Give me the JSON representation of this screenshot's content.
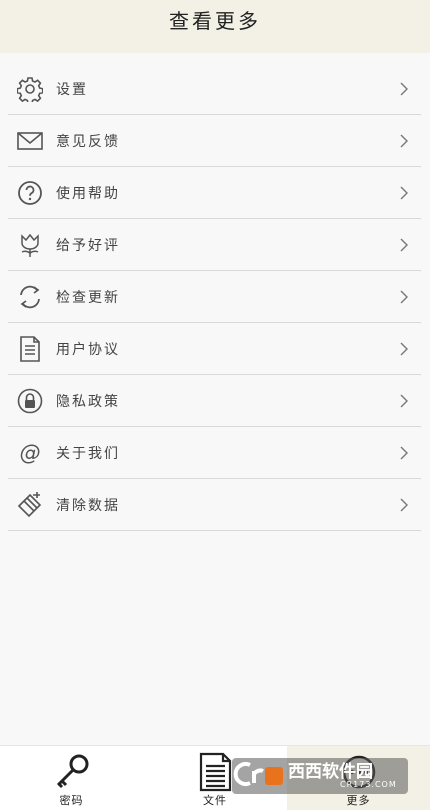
{
  "header": {
    "title": "查看更多"
  },
  "menu": [
    {
      "icon": "gear-icon",
      "label": "设置"
    },
    {
      "icon": "envelope-icon",
      "label": "意见反馈"
    },
    {
      "icon": "question-icon",
      "label": "使用帮助"
    },
    {
      "icon": "flower-icon",
      "label": "给予好评"
    },
    {
      "icon": "refresh-icon",
      "label": "检查更新"
    },
    {
      "icon": "document-icon",
      "label": "用户协议"
    },
    {
      "icon": "lock-icon",
      "label": "隐私政策"
    },
    {
      "icon": "at-icon",
      "label": "关于我们"
    },
    {
      "icon": "eraser-icon",
      "label": "清除数据"
    }
  ],
  "tabbar": {
    "tabs": [
      {
        "icon": "key-icon",
        "label": "密码"
      },
      {
        "icon": "document-icon",
        "label": "文件"
      },
      {
        "icon": "more-icon",
        "label": "更多"
      }
    ],
    "active_index": 2
  },
  "watermark": {
    "text": "西西软件园",
    "sub": "CR173.COM"
  },
  "colors": {
    "header_bg": "#f3f0e5",
    "page_bg": "#f8f8f8",
    "divider": "#d9d9d9",
    "icon": "#555555"
  }
}
